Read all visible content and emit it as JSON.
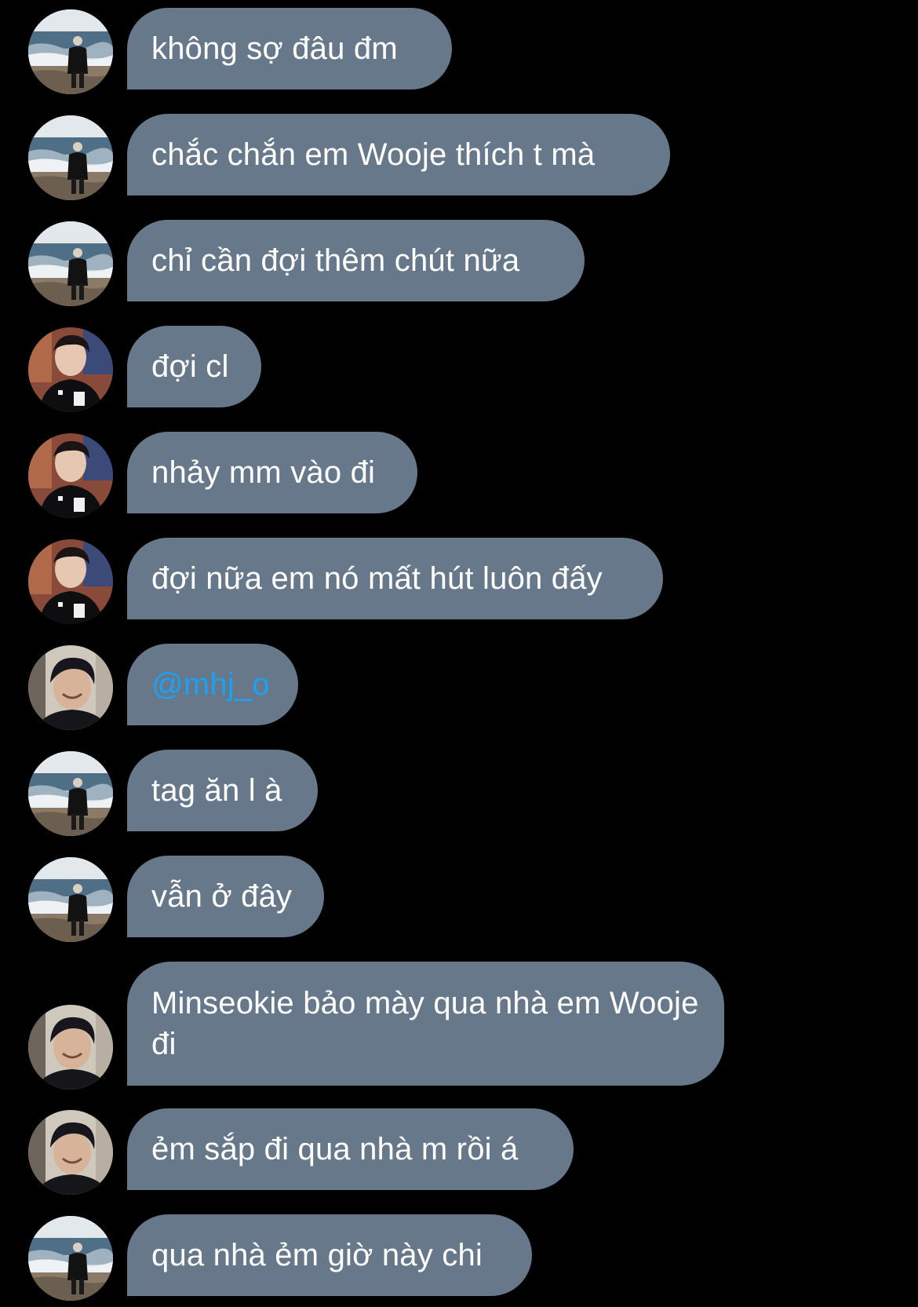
{
  "colors": {
    "background": "#000000",
    "bubble": "#66788a",
    "text": "#ffffff",
    "mention": "#1da1f2"
  },
  "messages": [
    {
      "avatar": "beach-avatar",
      "text": "không sợ đâu đm"
    },
    {
      "avatar": "beach-avatar",
      "text": "chắc chắn em Wooje thích t mà"
    },
    {
      "avatar": "beach-avatar",
      "text": "chỉ cần đợi thêm chút nữa"
    },
    {
      "avatar": "black-shirt-avatar",
      "text": "đợi cl"
    },
    {
      "avatar": "black-shirt-avatar",
      "text": "nhảy mm vào đi"
    },
    {
      "avatar": "black-shirt-avatar",
      "text": "đợi nữa em nó mất hút luôn đấy"
    },
    {
      "avatar": "smiling-boy-avatar",
      "text": "@mhj_o"
    },
    {
      "avatar": "beach-avatar",
      "text": "tag ăn l à"
    },
    {
      "avatar": "beach-avatar",
      "text": "vẫn ở đây"
    },
    {
      "avatar": "smiling-boy-avatar",
      "text": "Minseokie bảo mày qua nhà em Wooje đi"
    },
    {
      "avatar": "smiling-boy-avatar",
      "text": "ẻm sắp đi qua nhà m rồi á"
    },
    {
      "avatar": "beach-avatar",
      "text": "qua nhà ẻm giờ này chi"
    }
  ]
}
